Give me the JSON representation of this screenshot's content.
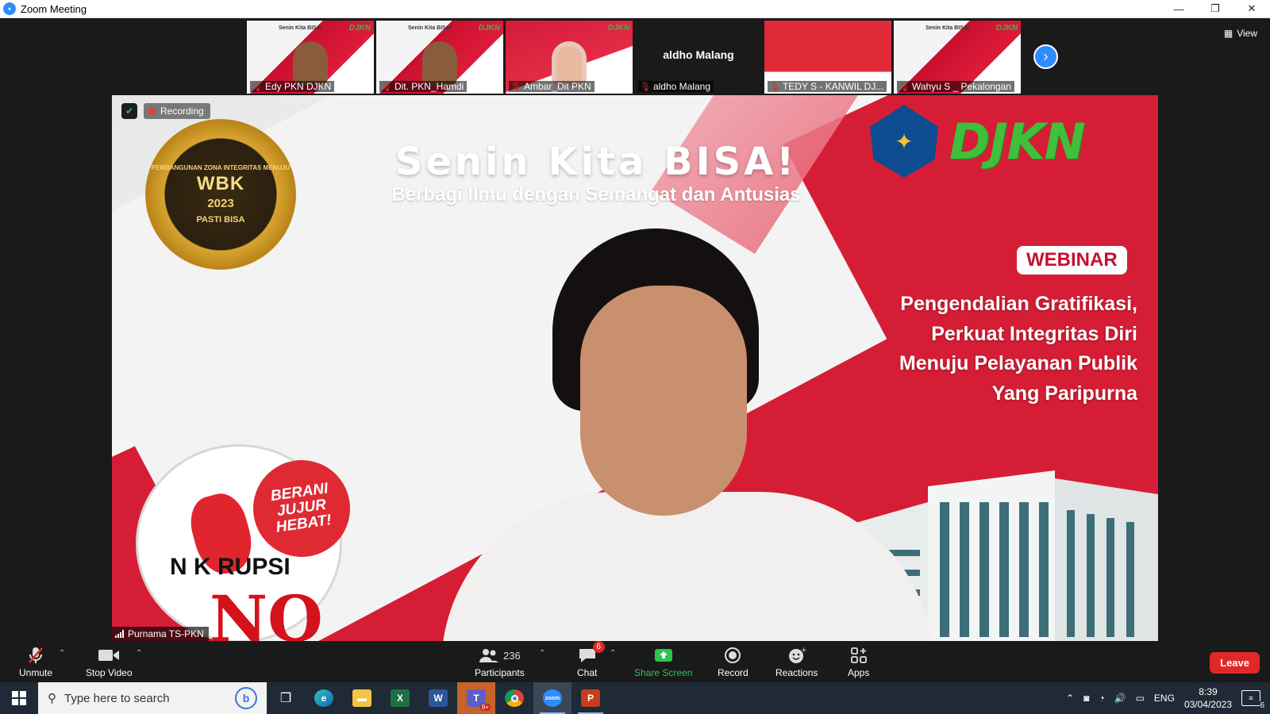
{
  "window": {
    "title": "Zoom Meeting",
    "minimize": "—",
    "restore": "❐",
    "close": "✕"
  },
  "view_button": {
    "label": "View"
  },
  "thumbnails": [
    {
      "name": "Edy PKN DJKN",
      "type": "slide-person"
    },
    {
      "name": "Dit. PKN_Hamdi",
      "type": "slide-person"
    },
    {
      "name": "Ambar_Dit PKN",
      "type": "slide-hijab"
    },
    {
      "name": "aldho  Malang",
      "type": "no-video",
      "center": "aldho  Malang"
    },
    {
      "name": "TEDY S - KANWIL DJ...",
      "type": "asean"
    },
    {
      "name": "Wahyu S _ Pekalongan",
      "type": "slide"
    }
  ],
  "thumb_slide": {
    "mini_title": "Senin Kita BISA!",
    "mini_logo": "DJKN"
  },
  "main": {
    "recording_label": "Recording",
    "speaker": "Purnama TS-PKN",
    "slide": {
      "badge_top": "PEMBANGUNAN ZONA INTEGRITAS MENUJU",
      "badge_main": "WBK",
      "badge_year": "2023",
      "badge_bottom": "PASTI BISA",
      "headline": "Senin Kita BISA!",
      "subheadline": "Berbagi Ilmu dengan Semangat dan Antusias",
      "logo": "DJKN",
      "webinar": "WEBINAR",
      "topic_lines": [
        "Pengendalian Gratifikasi,",
        "Perkuat Integritas Diri",
        "Menuju Pelayanan Publik",
        "Yang Paripurna"
      ],
      "no_korupsi": "N   K   RUPSI",
      "berani": "BERANI JUJUR HEBAT!",
      "big_n": "NO"
    }
  },
  "toolbar": {
    "unmute": "Unmute",
    "stop_video": "Stop Video",
    "participants": "Participants",
    "participants_count": "236",
    "chat": "Chat",
    "chat_badge": "6",
    "share_screen": "Share Screen",
    "record": "Record",
    "reactions": "Reactions",
    "apps": "Apps",
    "leave": "Leave"
  },
  "taskbar": {
    "search_placeholder": "Type here to search",
    "teams_badge": "9+",
    "lang": "ENG",
    "time": "8:39",
    "date": "03/04/2023",
    "notifications": "6"
  }
}
